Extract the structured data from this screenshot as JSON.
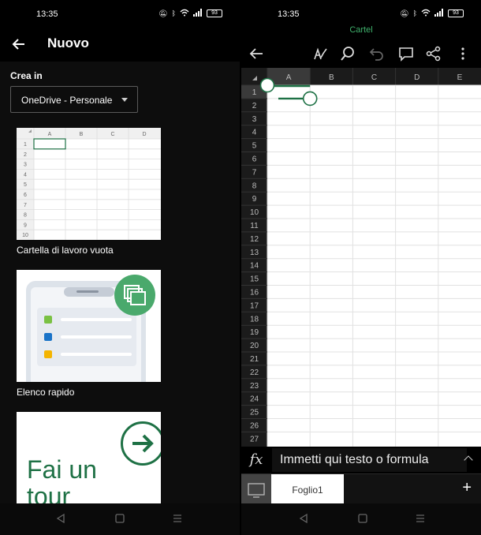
{
  "left": {
    "status": {
      "time": "13:35",
      "battery": "93"
    },
    "appbar": {
      "title": "Nuovo"
    },
    "crea_in_label": "Crea in",
    "location_dropdown": {
      "value": "OneDrive - Personale"
    },
    "templates": [
      {
        "label": "Cartella di lavoro vuota"
      },
      {
        "label": "Elenco rapido"
      },
      {
        "label": "",
        "text_line1": "Fai un",
        "text_line2": "tour"
      }
    ],
    "mini_grid": {
      "columns": [
        "A",
        "B",
        "C",
        "D"
      ],
      "rows": [
        "1",
        "2",
        "3",
        "4",
        "5",
        "6",
        "7",
        "8",
        "9",
        "10"
      ]
    }
  },
  "right": {
    "status": {
      "time": "13:35",
      "battery": "93"
    },
    "workbook_title": "Cartel",
    "grid": {
      "columns": [
        "A",
        "B",
        "C",
        "D",
        "E"
      ],
      "rows": [
        "1",
        "2",
        "3",
        "4",
        "5",
        "6",
        "7",
        "8",
        "9",
        "10",
        "11",
        "12",
        "13",
        "14",
        "15",
        "16",
        "17",
        "18",
        "19",
        "20",
        "21",
        "22",
        "23",
        "24",
        "25",
        "26",
        "27"
      ]
    },
    "formula_bar": {
      "fx": "fx",
      "placeholder": "Immetti qui testo o formula"
    },
    "sheet_tabs": {
      "tab1": "Foglio1",
      "add": "+"
    }
  },
  "colors": {
    "accent_green": "#1e7145",
    "title_green": "#3fb16c",
    "bg": "#000000"
  }
}
